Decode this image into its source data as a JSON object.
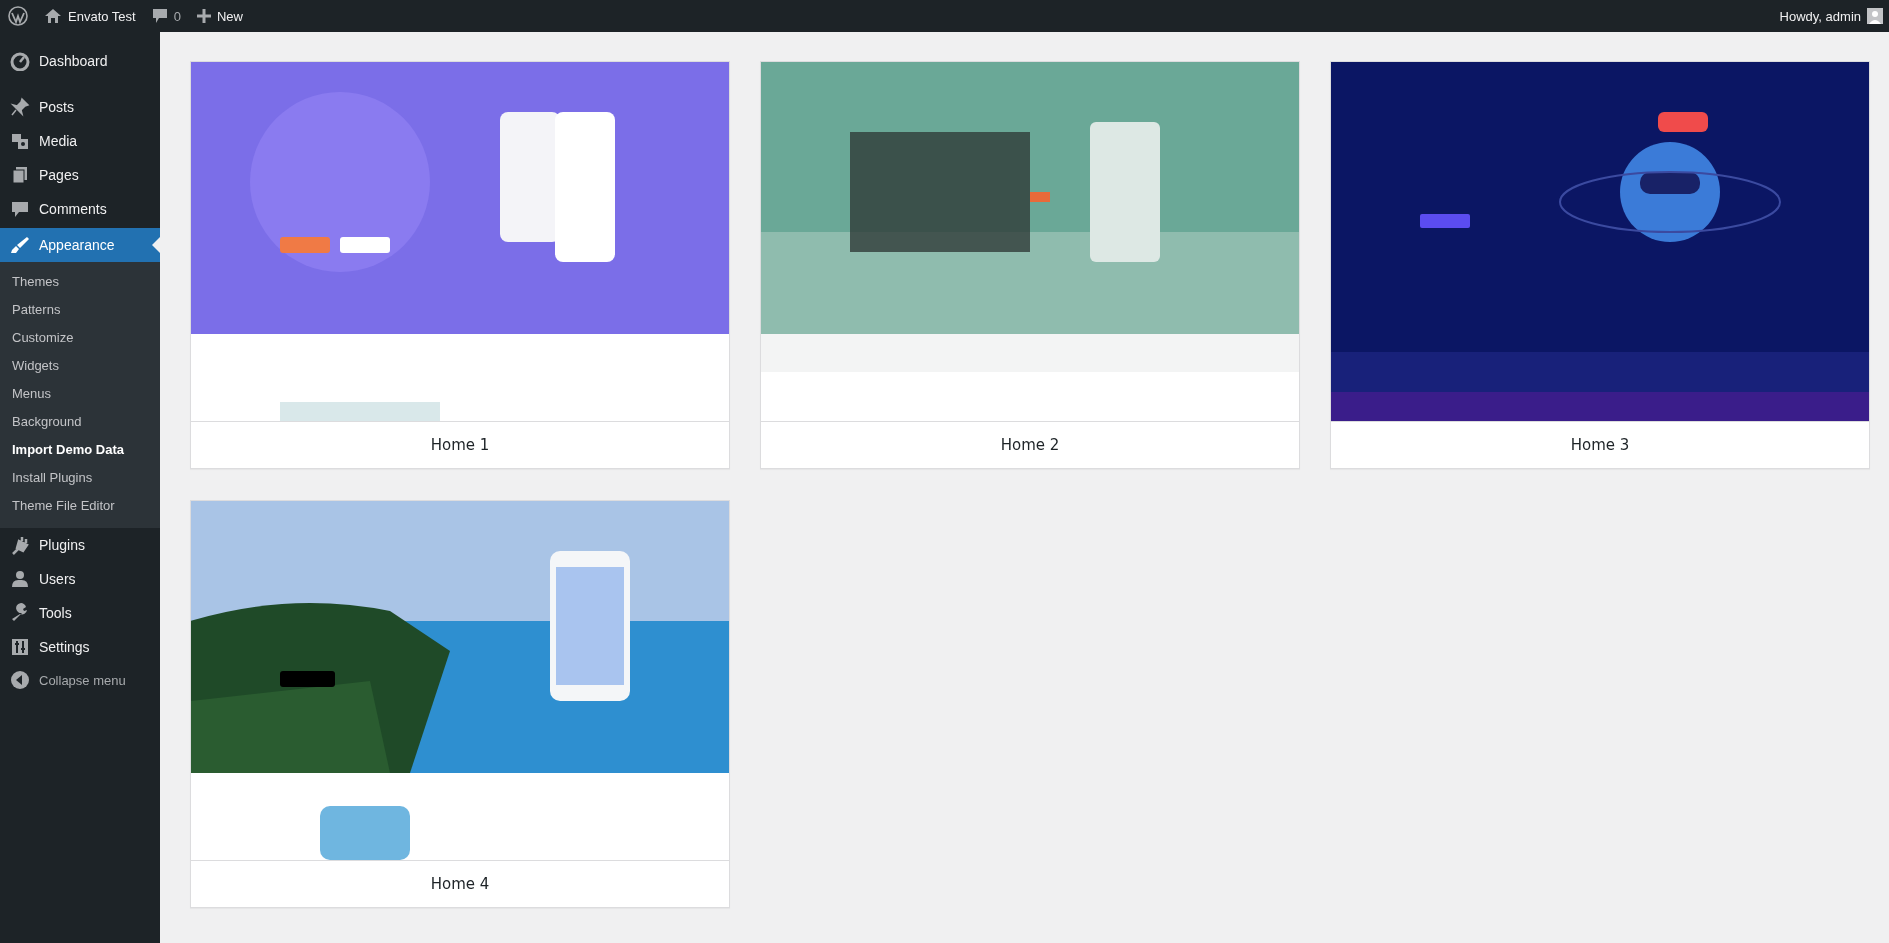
{
  "admin_bar": {
    "site_name": "Envato Test",
    "comments_count": "0",
    "new_label": "New",
    "greeting": "Howdy, admin"
  },
  "sidebar": {
    "items": [
      {
        "label": "Dashboard",
        "selected": false
      },
      {
        "label": "Posts",
        "selected": false
      },
      {
        "label": "Media",
        "selected": false
      },
      {
        "label": "Pages",
        "selected": false
      },
      {
        "label": "Comments",
        "selected": false
      },
      {
        "label": "Appearance",
        "selected": true,
        "children": [
          {
            "label": "Themes",
            "selected": false
          },
          {
            "label": "Patterns",
            "selected": false
          },
          {
            "label": "Customize",
            "selected": false
          },
          {
            "label": "Widgets",
            "selected": false
          },
          {
            "label": "Menus",
            "selected": false
          },
          {
            "label": "Background",
            "selected": false
          },
          {
            "label": "Import Demo Data",
            "selected": true
          },
          {
            "label": "Install Plugins",
            "selected": false
          },
          {
            "label": "Theme File Editor",
            "selected": false
          }
        ]
      },
      {
        "label": "Plugins",
        "selected": false
      },
      {
        "label": "Users",
        "selected": false
      },
      {
        "label": "Tools",
        "selected": false
      },
      {
        "label": "Settings",
        "selected": false
      }
    ],
    "collapse_label": "Collapse menu"
  },
  "demos": [
    {
      "title": "Home 1"
    },
    {
      "title": "Home 2"
    },
    {
      "title": "Home 3"
    },
    {
      "title": "Home 4"
    }
  ]
}
